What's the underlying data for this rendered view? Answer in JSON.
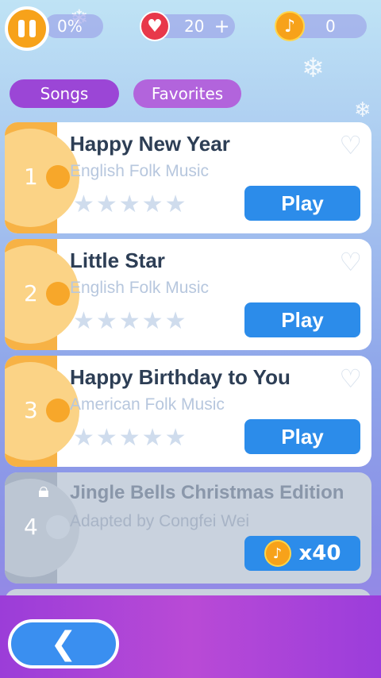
{
  "hud": {
    "progress_text": "0%",
    "lives": "20",
    "lives_add": "+",
    "coins": "0"
  },
  "tabs": [
    {
      "label": "Songs",
      "color": "#9b46d6",
      "active": true
    },
    {
      "label": "Favorites",
      "color": "#b264dc",
      "active": false
    }
  ],
  "songs": [
    {
      "number": "1",
      "title": "Happy New Year",
      "artist": "English Folk Music",
      "action": "Play",
      "locked": false
    },
    {
      "number": "2",
      "title": "Little Star",
      "artist": "English Folk Music",
      "action": "Play",
      "locked": false
    },
    {
      "number": "3",
      "title": "Happy Birthday to You",
      "artist": "American Folk Music",
      "action": "Play",
      "locked": false
    },
    {
      "number": "4",
      "title": "Jingle Bells Christmas Edition",
      "artist": "Adapted by Congfei Wei",
      "price": "x40",
      "locked": true
    }
  ],
  "icons": {
    "pause": "pause-icon",
    "heart": "heart-icon",
    "note_coin": "music-note-coin-icon",
    "favorite": "heart-outline-icon",
    "star": "star-icon",
    "lock": "lock-icon",
    "back": "chevron-left-icon"
  },
  "colors": {
    "accent": "#f7a21a",
    "play_button": "#2c8cea",
    "heart_red": "#e8384a"
  }
}
